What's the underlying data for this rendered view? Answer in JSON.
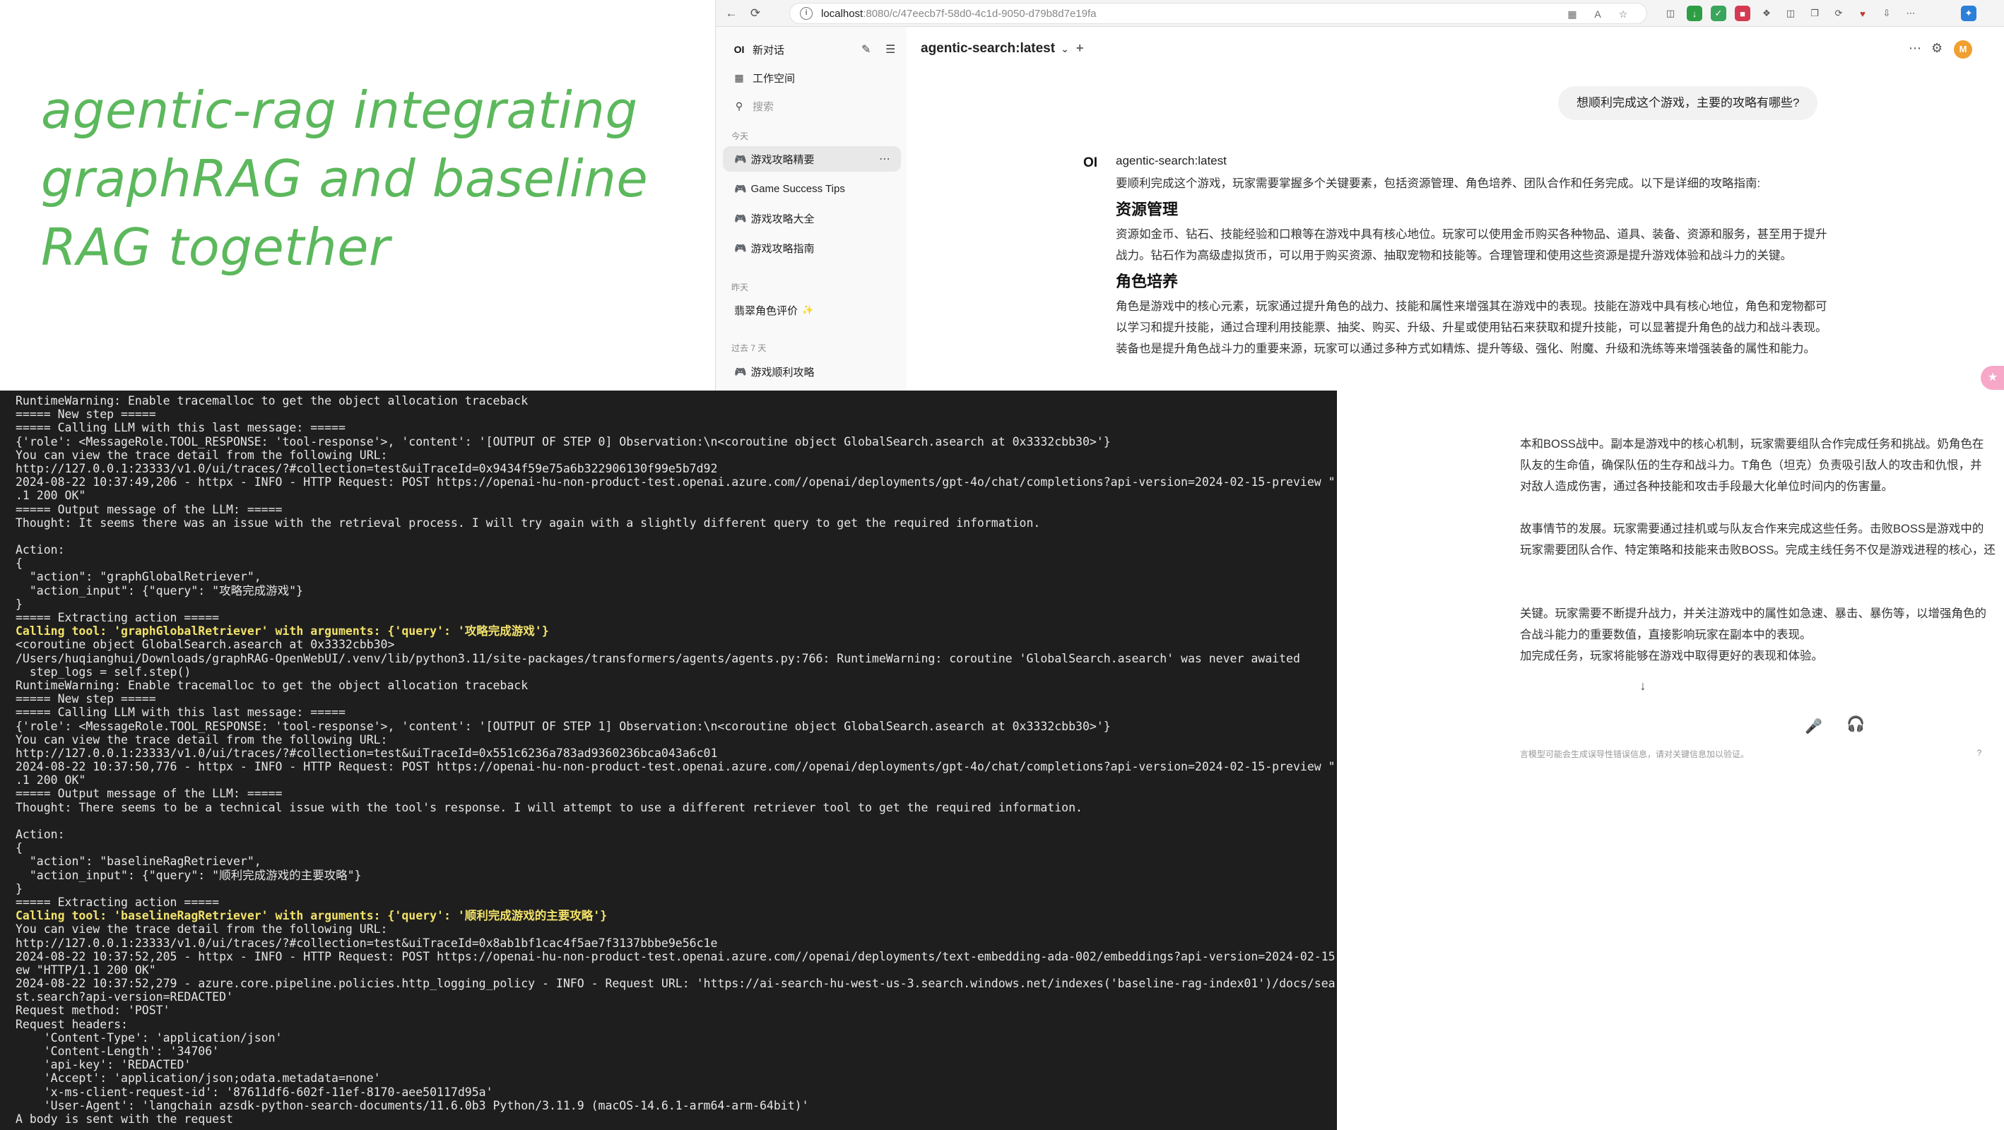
{
  "headline": {
    "lines": [
      "agentic-rag integrating",
      "graphRAG and baseline",
      "RAG together"
    ]
  },
  "browser": {
    "url_host": "localhost",
    "url_rest": ":8080/c/47eecb7f-58d0-4c1d-9050-d79b8d7e19fa"
  },
  "sidebar": {
    "new_chat": "新对话",
    "workspace": "工作空间",
    "search_placeholder": "搜索",
    "groups": {
      "today": "今天",
      "yesterday": "昨天",
      "last7": "过去 7 天"
    },
    "today_chats": [
      {
        "label": "游戏攻略精要",
        "active": true
      },
      {
        "label": "Game Success Tips",
        "active": false
      },
      {
        "label": "游戏攻略大全",
        "active": false
      },
      {
        "label": "游戏攻略指南",
        "active": false
      }
    ],
    "yesterday_chats": [
      {
        "label": "翡翠角色评价"
      }
    ],
    "last7_chats": [
      {
        "label": "游戏顺利攻略"
      }
    ]
  },
  "chat": {
    "model_title": "agentic-search:latest",
    "user_message": "想顺利完成这个游戏，主要的攻略有哪些?",
    "assistant_name": "agentic-search:latest",
    "assistant_logo": "OI",
    "user_initial": "M",
    "answer_intro": "要顺利完成这个游戏，玩家需要掌握多个关键要素，包括资源管理、角色培养、团队合作和任务完成。以下是详细的攻略指南:",
    "section1_title": "资源管理",
    "section1_text": "资源如金币、钻石、技能经验和口粮等在游戏中具有核心地位。玩家可以使用金币购买各种物品、道具、装备、资源和服务，甚至用于提升战力。钻石作为高级虚拟货币，可以用于购买资源、抽取宠物和技能等。合理管理和使用这些资源是提升游戏体验和战斗力的关键。",
    "section2_title": "角色培养",
    "section2_text": "角色是游戏中的核心元素，玩家通过提升角色的战力、技能和属性来增强其在游戏中的表现。技能在游戏中具有核心地位，角色和宠物都可以学习和提升技能，通过合理利用技能票、抽奖、购买、升级、升星或使用钻石来获取和提升技能，可以显著提升角色的战力和战斗表现。装备也是提升角色战斗力的重要来源，玩家可以通过多种方式如精炼、提升等级、强化、附魔、升级和洗练等来增强装备的属性和能力。",
    "tail_lines": [
      "本和BOSS战中。副本是游戏中的核心机制，玩家需要组队合作完成任务和挑战。奶角色在",
      "队友的生命值，确保队伍的生存和战斗力。T角色（坦克）负责吸引敌人的攻击和仇恨，并",
      "对敌人造成伤害，通过各种技能和攻击手段最大化单位时间内的伤害量。",
      "",
      "故事情节的发展。玩家需要通过挂机或与队友合作来完成这些任务。击败BOSS是游戏中的",
      "玩家需要团队合作、特定策略和技能来击败BOSS。完成主线任务不仅是游戏进程的核心，还",
      "",
      "",
      "关键。玩家需要不断提升战力，并关注游戏中的属性如急速、暴击、暴伤等，以增强角色的",
      "合战斗能力的重要数值，直接影响玩家在副本中的表现。",
      "加完成任务，玩家将能够在游戏中取得更好的表现和体验。"
    ],
    "disclaimer": "言模型可能会生成误导性错误信息，请对关键信息加以验证。",
    "help": "?"
  },
  "terminal": {
    "lines": [
      {
        "text": "RuntimeWarning: Enable tracemalloc to get the object allocation traceback",
        "hl": false
      },
      {
        "text": "===== New step =====",
        "hl": false
      },
      {
        "text": "===== Calling LLM with this last message: =====",
        "hl": false
      },
      {
        "text": "{'role': <MessageRole.TOOL_RESPONSE: 'tool-response'>, 'content': '[OUTPUT OF STEP 0] Observation:\\n<coroutine object GlobalSearch.asearch at 0x3332cbb30>'}",
        "hl": false
      },
      {
        "text": "You can view the trace detail from the following URL:",
        "hl": false
      },
      {
        "text": "http://127.0.0.1:23333/v1.0/ui/traces/?#collection=test&uiTraceId=0x9434f59e75a6b322906130f99e5b7d92",
        "hl": false
      },
      {
        "text": "2024-08-22 10:37:49,206 - httpx - INFO - HTTP Request: POST https://openai-hu-non-product-test.openai.azure.com//openai/deployments/gpt-4o/chat/completions?api-version=2024-02-15-preview \"HTTP/1",
        "hl": false
      },
      {
        "text": ".1 200 OK\"",
        "hl": false
      },
      {
        "text": "===== Output message of the LLM: =====",
        "hl": false
      },
      {
        "text": "Thought: It seems there was an issue with the retrieval process. I will try again with a slightly different query to get the required information.",
        "hl": false
      },
      {
        "text": "",
        "hl": false
      },
      {
        "text": "Action:",
        "hl": false
      },
      {
        "text": "{",
        "hl": false
      },
      {
        "text": "  \"action\": \"graphGlobalRetriever\",",
        "hl": false
      },
      {
        "text": "  \"action_input\": {\"query\": \"攻略完成游戏\"}",
        "hl": false
      },
      {
        "text": "}",
        "hl": false
      },
      {
        "text": "===== Extracting action =====",
        "hl": false
      },
      {
        "text": "Calling tool: 'graphGlobalRetriever' with arguments: {'query': '攻略完成游戏'}",
        "hl": true
      },
      {
        "text": "<coroutine object GlobalSearch.asearch at 0x3332cbb30>",
        "hl": false
      },
      {
        "text": "/Users/huqianghui/Downloads/graphRAG-OpenWebUI/.venv/lib/python3.11/site-packages/transformers/agents/agents.py:766: RuntimeWarning: coroutine 'GlobalSearch.asearch' was never awaited",
        "hl": false
      },
      {
        "text": "  step_logs = self.step()",
        "hl": false
      },
      {
        "text": "RuntimeWarning: Enable tracemalloc to get the object allocation traceback",
        "hl": false
      },
      {
        "text": "===== New step =====",
        "hl": false
      },
      {
        "text": "===== Calling LLM with this last message: =====",
        "hl": false
      },
      {
        "text": "{'role': <MessageRole.TOOL_RESPONSE: 'tool-response'>, 'content': '[OUTPUT OF STEP 1] Observation:\\n<coroutine object GlobalSearch.asearch at 0x3332cbb30>'}",
        "hl": false
      },
      {
        "text": "You can view the trace detail from the following URL:",
        "hl": false
      },
      {
        "text": "http://127.0.0.1:23333/v1.0/ui/traces/?#collection=test&uiTraceId=0x551c6236a783ad9360236bca043a6c01",
        "hl": false
      },
      {
        "text": "2024-08-22 10:37:50,776 - httpx - INFO - HTTP Request: POST https://openai-hu-non-product-test.openai.azure.com//openai/deployments/gpt-4o/chat/completions?api-version=2024-02-15-preview \"HTTP/1",
        "hl": false
      },
      {
        "text": ".1 200 OK\"",
        "hl": false
      },
      {
        "text": "===== Output message of the LLM: =====",
        "hl": false
      },
      {
        "text": "Thought: There seems to be a technical issue with the tool's response. I will attempt to use a different retriever tool to get the required information.",
        "hl": false
      },
      {
        "text": "",
        "hl": false
      },
      {
        "text": "Action:",
        "hl": false
      },
      {
        "text": "{",
        "hl": false
      },
      {
        "text": "  \"action\": \"baselineRagRetriever\",",
        "hl": false
      },
      {
        "text": "  \"action_input\": {\"query\": \"顺利完成游戏的主要攻略\"}",
        "hl": false
      },
      {
        "text": "}",
        "hl": false
      },
      {
        "text": "===== Extracting action =====",
        "hl": false
      },
      {
        "text": "Calling tool: 'baselineRagRetriever' with arguments: {'query': '顺利完成游戏的主要攻略'}",
        "hl": true
      },
      {
        "text": "You can view the trace detail from the following URL:",
        "hl": false
      },
      {
        "text": "http://127.0.0.1:23333/v1.0/ui/traces/?#collection=test&uiTraceId=0x8ab1bf1cac4f5ae7f3137bbbe9e56c1e",
        "hl": false
      },
      {
        "text": "2024-08-22 10:37:52,205 - httpx - INFO - HTTP Request: POST https://openai-hu-non-product-test.openai.azure.com//openai/deployments/text-embedding-ada-002/embeddings?api-version=2024-02-15-previ",
        "hl": false
      },
      {
        "text": "ew \"HTTP/1.1 200 OK\"",
        "hl": false
      },
      {
        "text": "2024-08-22 10:37:52,279 - azure.core.pipeline.policies.http_logging_policy - INFO - Request URL: 'https://ai-search-hu-west-us-3.search.windows.net/indexes('baseline-rag-index01')/docs/search.po",
        "hl": false
      },
      {
        "text": "st.search?api-version=REDACTED'",
        "hl": false
      },
      {
        "text": "Request method: 'POST'",
        "hl": false
      },
      {
        "text": "Request headers:",
        "hl": false
      },
      {
        "text": "    'Content-Type': 'application/json'",
        "hl": false
      },
      {
        "text": "    'Content-Length': '34706'",
        "hl": false
      },
      {
        "text": "    'api-key': 'REDACTED'",
        "hl": false
      },
      {
        "text": "    'Accept': 'application/json;odata.metadata=none'",
        "hl": false
      },
      {
        "text": "    'x-ms-client-request-id': '87611df6-602f-11ef-8170-aee50117d95a'",
        "hl": false
      },
      {
        "text": "    'User-Agent': 'langchain azsdk-python-search-documents/11.6.0b3 Python/3.11.9 (macOS-14.6.1-arm64-arm-64bit)'",
        "hl": false
      },
      {
        "text": "A body is sent with the request",
        "hl": false
      }
    ]
  }
}
